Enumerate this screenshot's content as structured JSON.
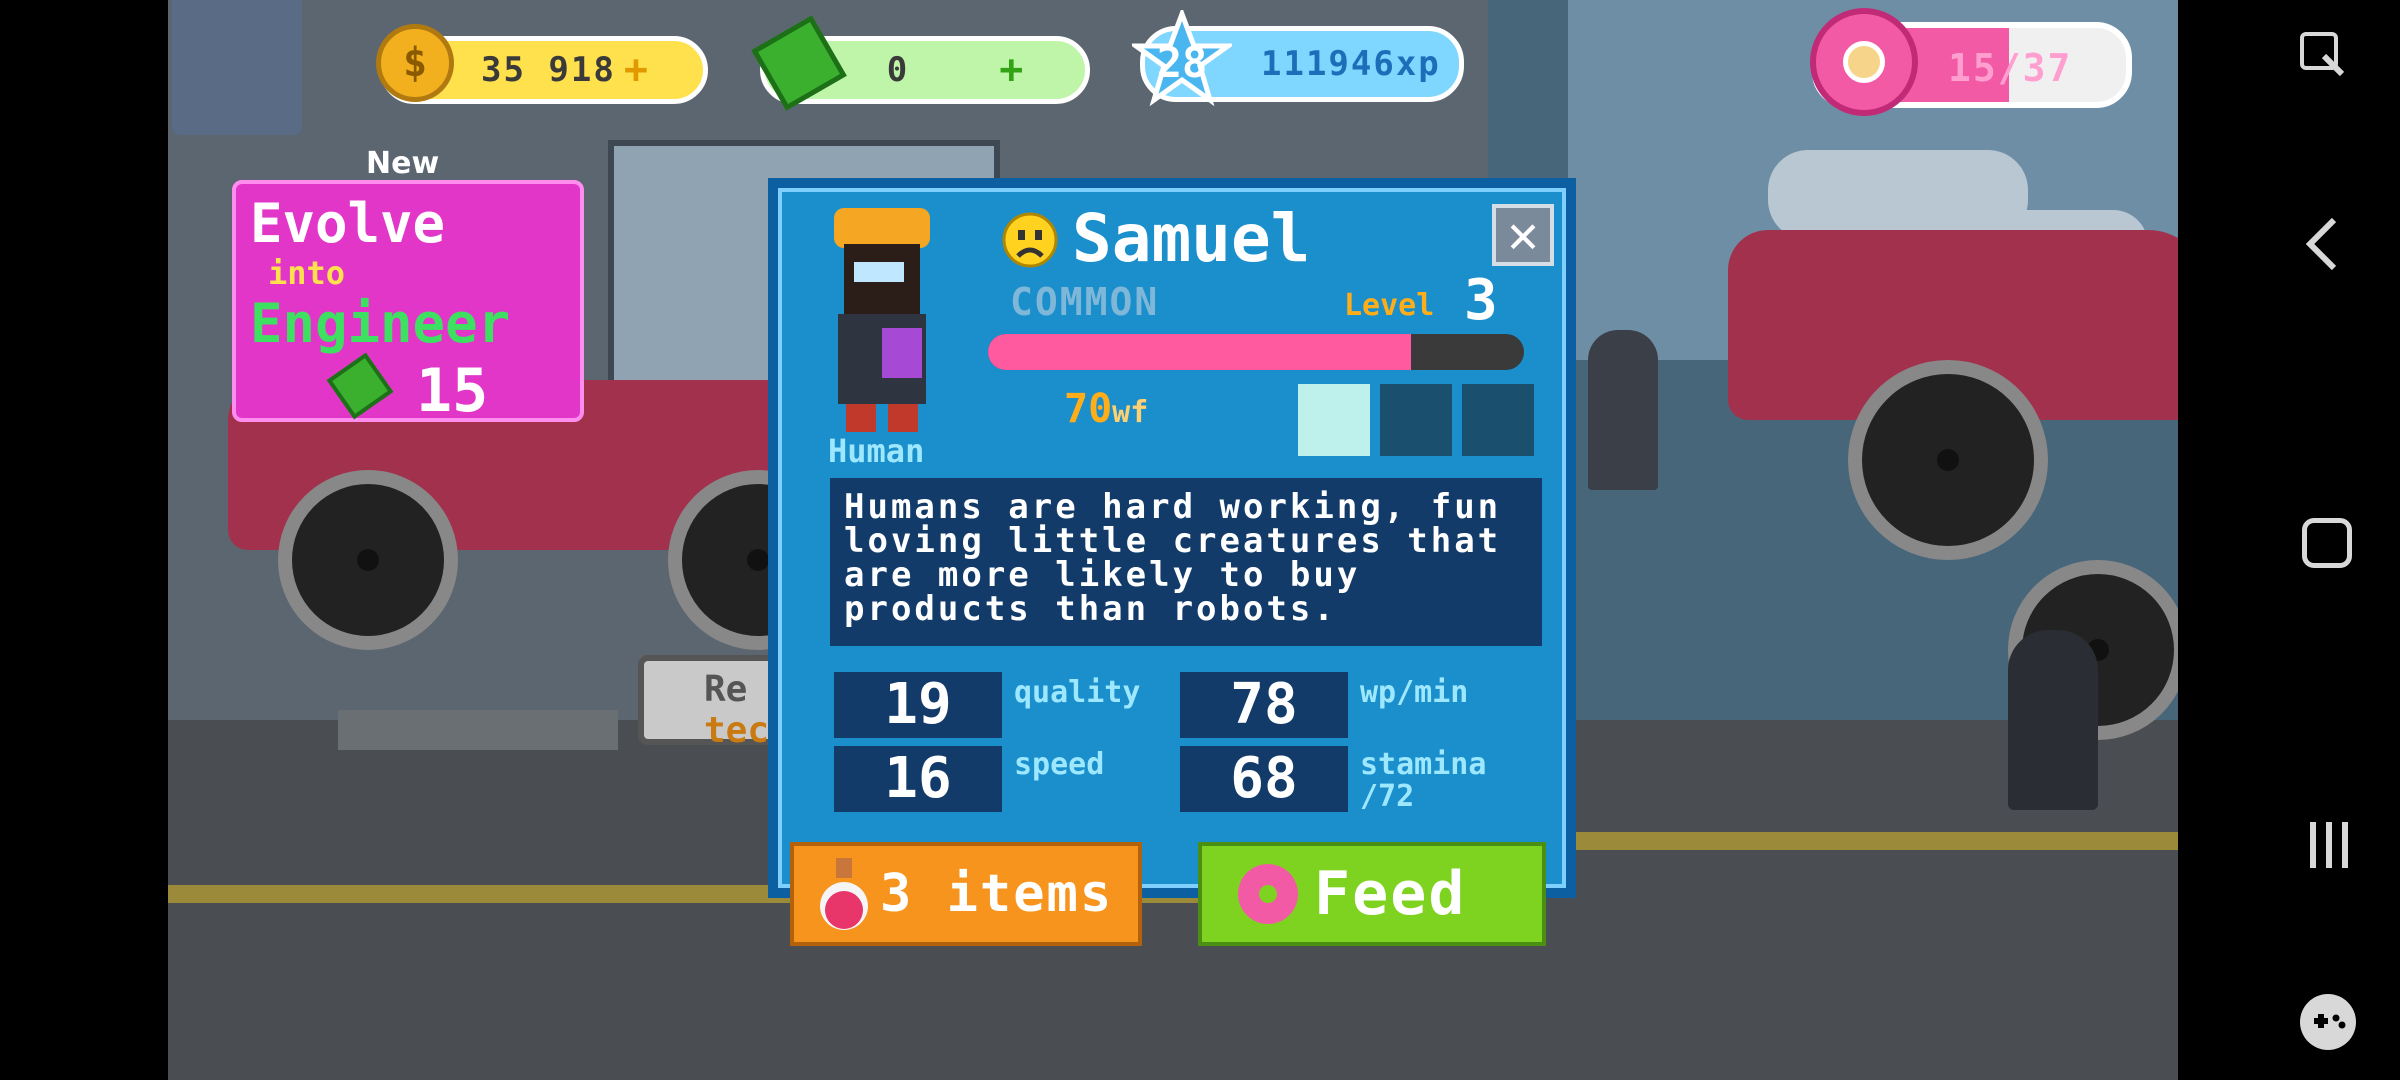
{
  "hud": {
    "coins": "35 918",
    "coin_plus": "+",
    "cash": "0",
    "cash_plus": "+",
    "level_badge": "28",
    "xp": "111946xp",
    "donuts": "15/37",
    "coin_icon": "coin-icon",
    "cash_icon": "cash-icon",
    "star_icon": "star-badge-icon",
    "donut_icon": "donut-icon"
  },
  "evolve": {
    "new_label": "New",
    "line1": "Evolve",
    "line2": "into",
    "line3": "Engineer",
    "cost": "15"
  },
  "background": {
    "sign_partial_1": "Re",
    "sign_partial_2": "tec"
  },
  "character": {
    "name": "Samuel",
    "mood_icon": "sad-face-icon",
    "rarity": "COMMON",
    "level_label": "Level",
    "level_value": "3",
    "progress_fraction": 0.79,
    "wf_value": "70",
    "wf_unit": "wf",
    "species": "Human",
    "slots_filled": 1,
    "slots_total": 3,
    "description": "Humans are hard working, fun loving little creatures that are more likely to buy products than robots."
  },
  "stats": [
    {
      "value": "19",
      "label": "quality"
    },
    {
      "value": "78",
      "label": "wp/min"
    },
    {
      "value": "16",
      "label": "speed"
    },
    {
      "value": "68",
      "label": "stamina",
      "sub": "/72"
    }
  ],
  "buttons": {
    "items": "3 items",
    "feed": "Feed"
  },
  "colors": {
    "dialog": "#1a8fcc",
    "feed": "#7ed321",
    "items": "#f7941d",
    "evolve": "#e236c9",
    "progress": "#ff5aa0"
  }
}
